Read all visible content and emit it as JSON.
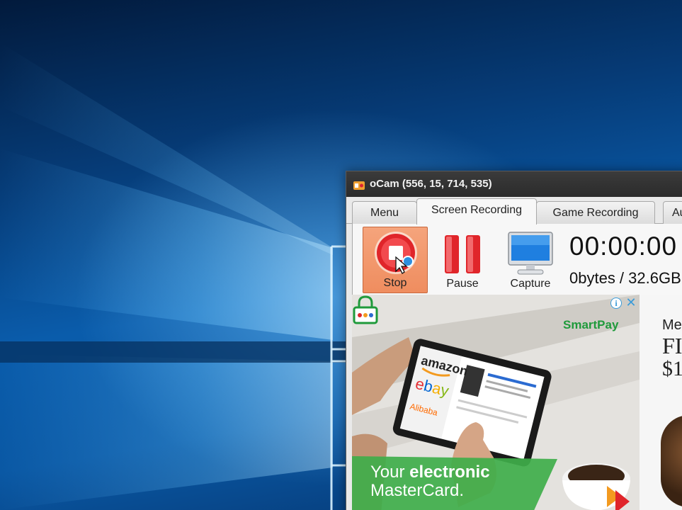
{
  "window": {
    "title": "oCam (556, 15, 714, 535)"
  },
  "tabs": [
    {
      "label": "Menu"
    },
    {
      "label": "Screen Recording"
    },
    {
      "label": "Game Recording"
    },
    {
      "label": "Au"
    }
  ],
  "toolbar": {
    "stop_label": "Stop",
    "pause_label": "Pause",
    "capture_label": "Capture",
    "timer": "00:00:00",
    "size": "0bytes / 32.6GB"
  },
  "ad": {
    "brand": "SmartPay",
    "slogan_plain": "Your ",
    "slogan_bold": "electronic",
    "slogan_line2": "MasterCard.",
    "logos": [
      "amazon",
      "ebay",
      "Alibaba"
    ],
    "info_symbol": "i",
    "close_symbol": "✕",
    "side_line1": "Me",
    "side_line2": "FI",
    "side_line3": "$1"
  },
  "colors": {
    "stop_button": "#ef8d5f",
    "record_red": "#e0252a",
    "brand_green": "#1f9a3b",
    "titlebar": "#2b2b2b"
  },
  "icons": [
    "app-icon",
    "record-stop-icon",
    "pause-icon",
    "monitor-icon",
    "mouse-cursor-icon",
    "lock-icon",
    "info-icon",
    "close-icon"
  ]
}
